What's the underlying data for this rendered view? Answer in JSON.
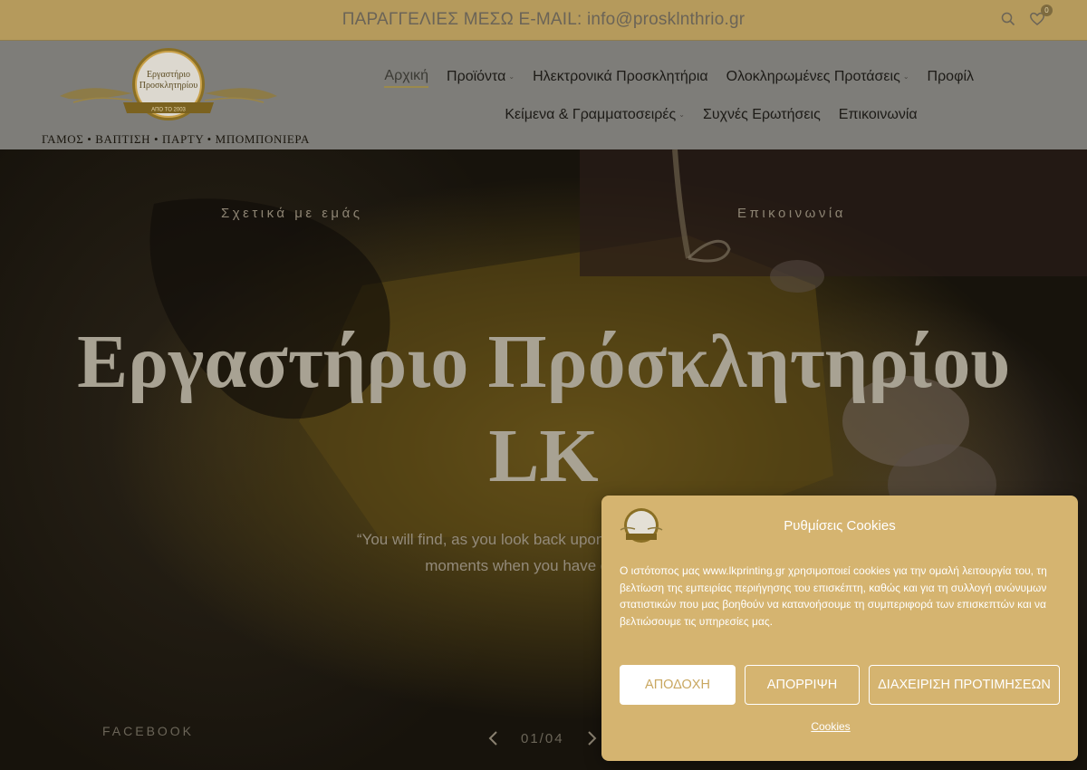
{
  "topbar": {
    "text": "ΠΑΡΑΓΓΕΛΙΕΣ ΜΕΣΩ E-MAIL: info@prosklnthrio.gr",
    "cart_count": "0",
    "icons": [
      "search-icon",
      "heart-icon"
    ]
  },
  "header": {
    "logo": {
      "line1": "Εργαστήριο",
      "line2": "Προσκλητηρίου",
      "ribbon": "ΑΠΟ ΤΟ 2003",
      "tagline": "ΓΑΜΟΣ • ΒΑΠΤΙΣΗ • ΠΑΡΤΥ • ΜΠΟΜΠΟΝΙΕΡΑ"
    },
    "nav": {
      "row1": [
        {
          "label": "Αρχική",
          "active": true,
          "dropdown": false
        },
        {
          "label": "Προϊόντα",
          "active": false,
          "dropdown": true
        },
        {
          "label": "Ηλεκτρονικά Προσκλητήρια",
          "active": false,
          "dropdown": false
        },
        {
          "label": "Ολοκληρωμένες Προτάσεις",
          "active": false,
          "dropdown": true
        },
        {
          "label": "Προφίλ",
          "active": false,
          "dropdown": false
        }
      ],
      "row2": [
        {
          "label": "Κείμενα & Γραμματοσειρές",
          "active": false,
          "dropdown": true
        },
        {
          "label": "Συχνές Ερωτήσεις",
          "active": false,
          "dropdown": false
        },
        {
          "label": "Επικοινωνία",
          "active": false,
          "dropdown": false
        }
      ]
    }
  },
  "hero": {
    "link_about": "Σχετικά με εμάς",
    "link_contact": "Επικοινωνία",
    "title_line1": "Εργαστήριο Πρόσκλητηρίου",
    "title_line2": "LK",
    "quote_line1": "“You will find, as you look back upon your life, that the mo",
    "quote_line2": "moments when you have done things",
    "facebook": "FACEBOOK",
    "slider_counter": "01/04"
  },
  "cookie": {
    "title": "Ρυθμίσεις Cookies",
    "text": "Ο ιστότοπος μας www.lkprinting.gr χρησιμοποιεί cookies για την ομαλή λειτουργία του, τη βελτίωση της εμπειρίας περιήγησης του επισκέπτη, καθώς και για τη συλλογή ανώνυμων στατιστικών που μας βοηθούν να κατανοήσουμε τη συμπεριφορά των επισκεπτών και να βελτιώσουμε τις υπηρεσίες μας.",
    "accept": "ΑΠΟΔΟΧΗ",
    "deny": "ΑΠΟΡΡΙΨΗ",
    "preferences": "ΔΙΑΧΕΙΡΙΣΗ ΠΡΟΤΙΜΗΣΕΩΝ",
    "link": "Cookies"
  },
  "colors": {
    "topbar": "#b59a5c",
    "header": "#7e7d79",
    "accent": "#9b8a4c",
    "cookie_bg": "#d5b470"
  }
}
